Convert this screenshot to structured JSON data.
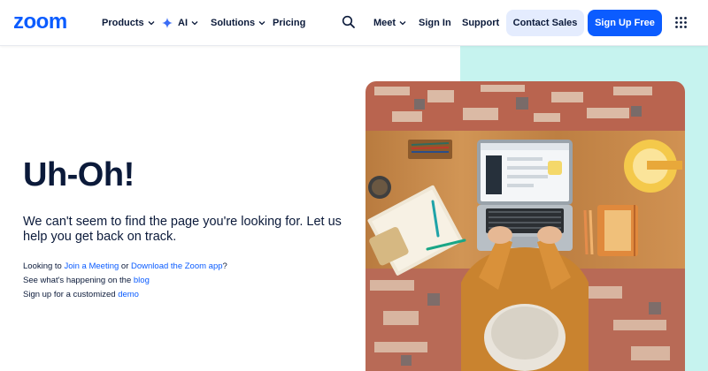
{
  "header": {
    "logo": "zoom",
    "nav": {
      "products": "Products",
      "ai": "AI",
      "solutions": "Solutions",
      "pricing": "Pricing",
      "meet": "Meet",
      "sign_in": "Sign In",
      "support": "Support"
    },
    "contact_sales": "Contact Sales",
    "sign_up_free": "Sign Up Free",
    "icons": [
      "search-icon",
      "apps-grid-icon",
      "chevron-down-icon",
      "ai-sparkle-icon"
    ]
  },
  "content": {
    "title": "Uh-Oh!",
    "subtitle": "We can't seem to find the page you're looking for. Let us help you get back on track.",
    "line1": {
      "prefix": "Looking to ",
      "link1": "Join a Meeting",
      "middle": " or ",
      "link2": "Download the Zoom app",
      "suffix": "?"
    },
    "line2": {
      "prefix": "See what's happening on the ",
      "link": "blog"
    },
    "line3": {
      "prefix": "Sign up for a customized ",
      "link": "demo"
    }
  },
  "colors": {
    "brand": "#0b5cff",
    "text": "#0b1a3a",
    "teal_band": "#c6f3ef",
    "contact_bg": "#e4ecfe"
  }
}
